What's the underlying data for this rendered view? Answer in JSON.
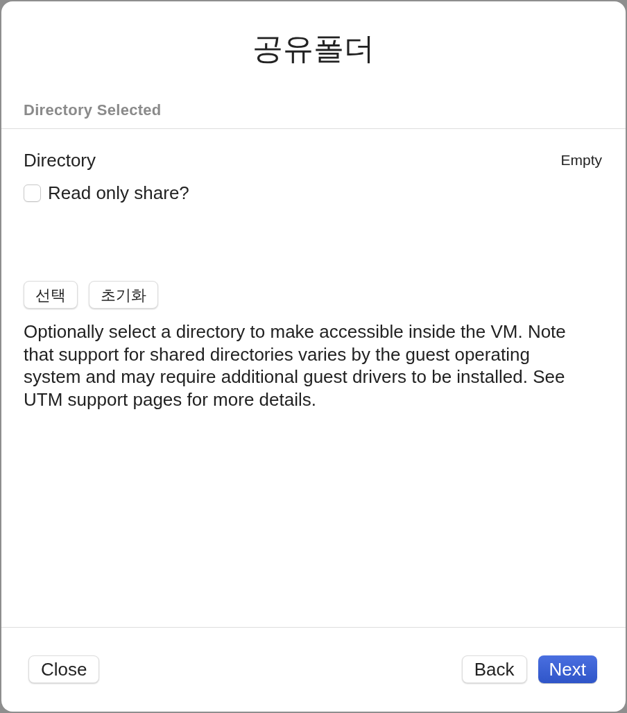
{
  "window": {
    "title": "공유폴더"
  },
  "section": {
    "header": "Directory Selected"
  },
  "directory": {
    "label": "Directory",
    "value": "Empty"
  },
  "read_only": {
    "label": "Read only share?",
    "checked": false
  },
  "directory_buttons": [
    "선택",
    "초기화"
  ],
  "description": "Optionally select a directory to make accessible inside the VM. Note that support for shared directories varies by the guest operating system and may require additional guest drivers to be installed. See UTM support pages for more details.",
  "footer": {
    "left_buttons": [
      {
        "label": "Close",
        "kind": "default"
      }
    ],
    "right_buttons": [
      {
        "label": "Back",
        "kind": "default"
      },
      {
        "label": "Next",
        "kind": "primary"
      }
    ]
  }
}
